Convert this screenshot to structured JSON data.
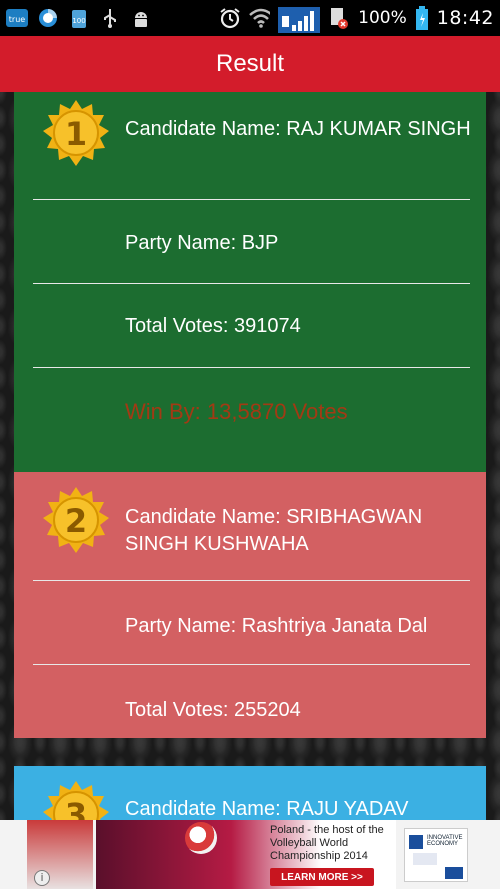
{
  "status_bar": {
    "icons": [
      "true-app-icon",
      "browser-icon",
      "battery-100-icon",
      "usb-icon",
      "android-icon",
      "alarm-icon",
      "wifi-icon",
      "signal-icon",
      "sim-error-icon"
    ],
    "true_label": "true",
    "battery_small": "100",
    "battery_percent": "100%",
    "time": "18:42"
  },
  "header": {
    "title": "Result"
  },
  "candidates": [
    {
      "rank": "1",
      "name_line": "Candidate Name: RAJ KUMAR SINGH",
      "party_line": "Party Name: BJP",
      "votes_line": "Total Votes: 391074",
      "win_line": "Win By: 13,5870 Votes",
      "color": "#1c6d30"
    },
    {
      "rank": "2",
      "name_line": "Candidate Name: SRIBHAGWAN SINGH KUSHWAHA",
      "party_line": "Party Name: Rashtriya Janata Dal",
      "votes_line": "Total Votes: 255204",
      "color": "#d36062"
    },
    {
      "rank": "3",
      "name_line": "Candidate Name: RAJU YADAV",
      "color": "#3bb0e3"
    }
  ],
  "ad": {
    "text": "Poland - the host of the Volleyball World Championship 2014",
    "button": "LEARN MORE >>",
    "logo_text": "INNOVATIVE ECONOMY",
    "info_icon": "info-icon"
  }
}
